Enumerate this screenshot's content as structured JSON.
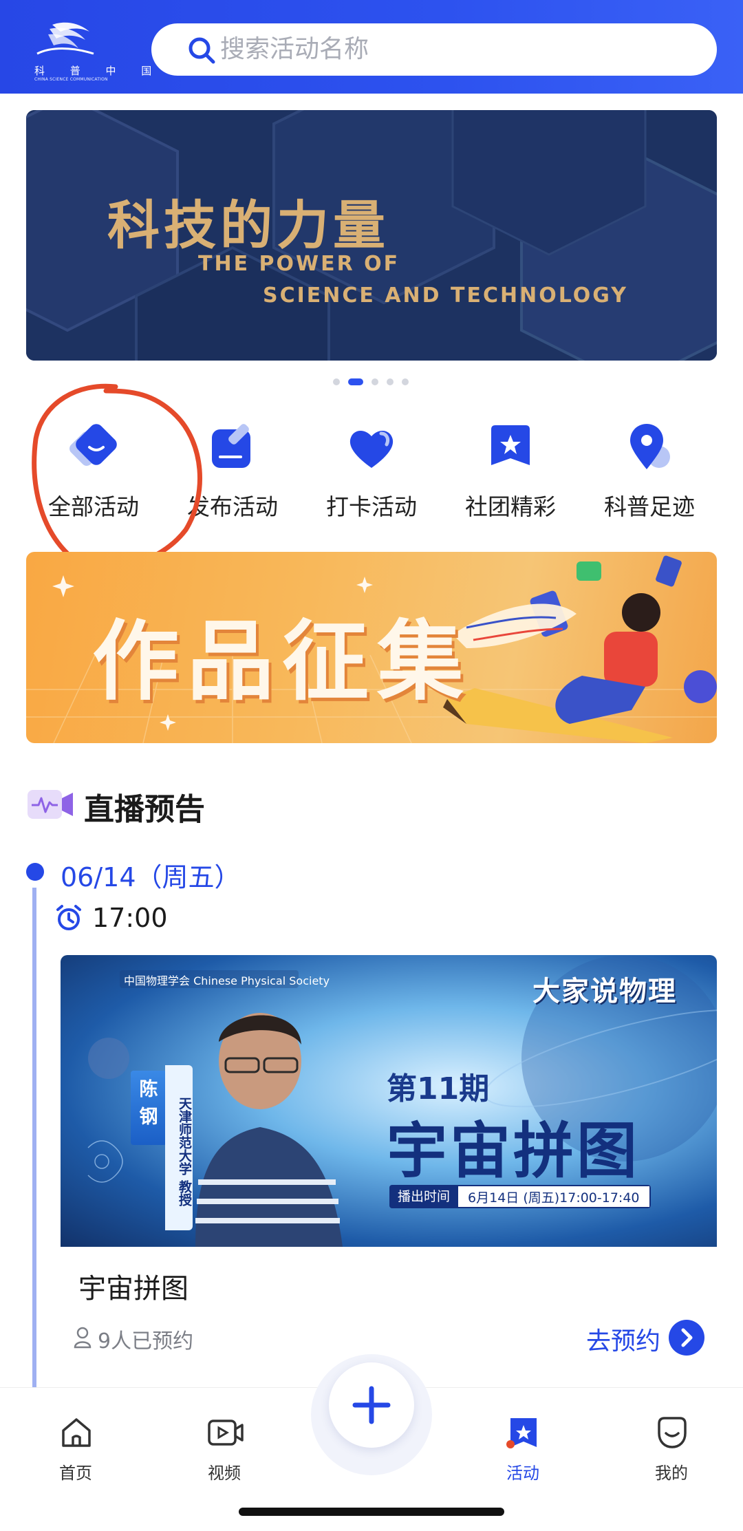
{
  "header": {
    "logo": {
      "name_cn": "科 普 中 国",
      "name_en": "CHINA SCIENCE COMMUNICATION",
      "icon": "kepu-china-logo"
    },
    "search": {
      "placeholder": "搜索活动名称",
      "icon": "search-icon"
    }
  },
  "top_banner": {
    "title": "科技的力量",
    "subtitle_line1": "THE POWER OF",
    "subtitle_line2": "SCIENCE AND TECHNOLOGY",
    "carousel": {
      "count": 5,
      "active_index": 1
    }
  },
  "quick_entries": [
    {
      "label": "全部活动",
      "icon": "all-activities-icon"
    },
    {
      "label": "发布活动",
      "icon": "publish-activity-icon"
    },
    {
      "label": "打卡活动",
      "icon": "checkin-heart-icon"
    },
    {
      "label": "社团精彩",
      "icon": "club-star-icon"
    },
    {
      "label": "科普足迹",
      "icon": "location-pin-icon"
    }
  ],
  "promo_banner": {
    "title": "作品征集"
  },
  "live_section": {
    "title": "直播预告",
    "icon": "live-camera-icon",
    "date": "06/14（周五）",
    "time": "17:00",
    "card": {
      "image": {
        "org": "中国物理学会 Chinese Physical Society",
        "brand": "大家说物理",
        "issue": "第11期",
        "title": "宇宙拼图",
        "speaker_name": "陈钢",
        "speaker_affiliation": "天津师范大学 教授",
        "air_time_label": "播出时间",
        "air_time_value": "6月14日 (周五)17:00-17:40"
      },
      "name": "宇宙拼图",
      "reserved_count": "9人已预约",
      "reserve_label": "去预约"
    }
  },
  "bottom_nav": {
    "items": [
      {
        "label": "首页",
        "icon": "home-icon"
      },
      {
        "label": "视频",
        "icon": "video-icon"
      },
      {
        "label": "活动",
        "icon": "activity-icon",
        "active": true
      },
      {
        "label": "我的",
        "icon": "profile-icon"
      }
    ],
    "fab_icon": "plus-icon"
  },
  "colors": {
    "primary": "#2548e6",
    "header": "#2d52ef",
    "gold": "#d9b074",
    "annotation": "#e54a2a"
  }
}
